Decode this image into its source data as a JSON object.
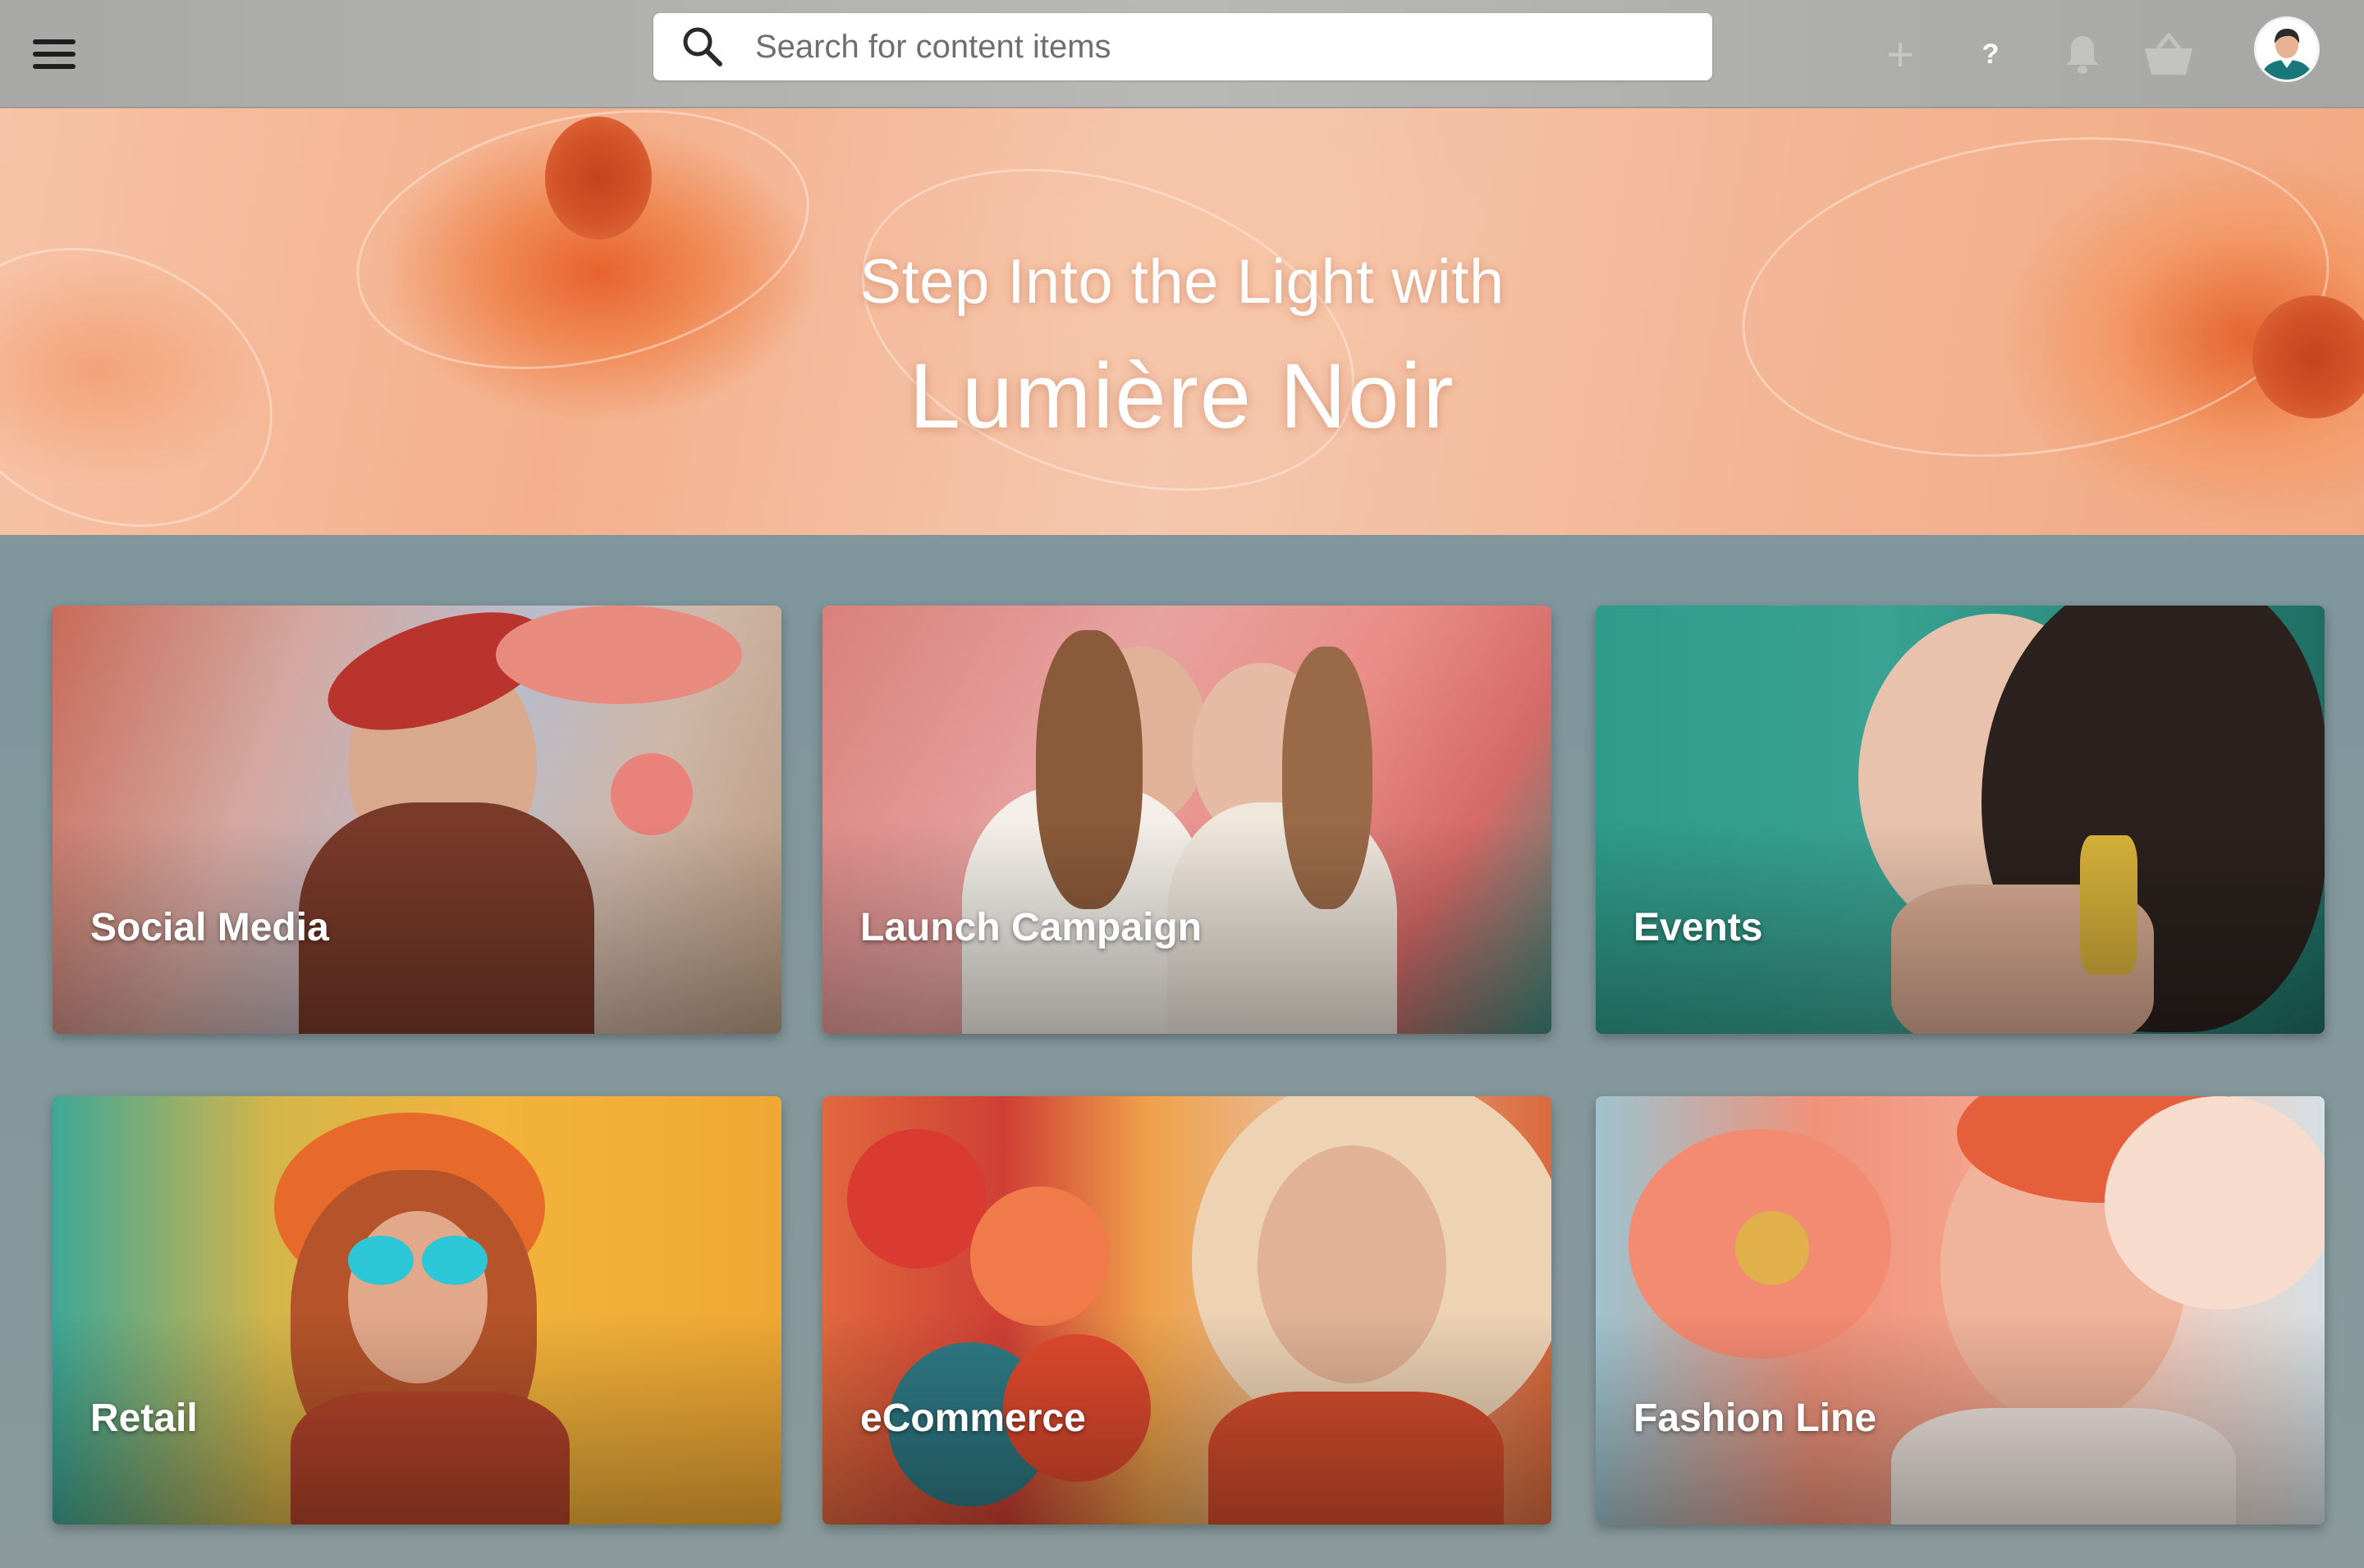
{
  "topbar": {
    "search": {
      "placeholder": "Search for content items",
      "value": ""
    },
    "icons": {
      "menu": "hamburger-menu-icon",
      "search": "search-icon",
      "add": "plus-icon",
      "help": "question-icon",
      "help_glyph": "?",
      "add_glyph": "+",
      "notifications": "bell-icon",
      "cart": "basket-icon",
      "profile": "avatar"
    }
  },
  "hero": {
    "line1": "Step Into the Light with",
    "line2": "Lumière Noir"
  },
  "cards": [
    {
      "label": "Social Media"
    },
    {
      "label": "Launch Campaign"
    },
    {
      "label": "Events"
    },
    {
      "label": "Retail"
    },
    {
      "label": "eCommerce"
    },
    {
      "label": "Fashion Line"
    }
  ],
  "colors": {
    "topbar": "#b0b0ae",
    "hero_accent": "#e8622e",
    "text_on_image": "#ffffff"
  }
}
